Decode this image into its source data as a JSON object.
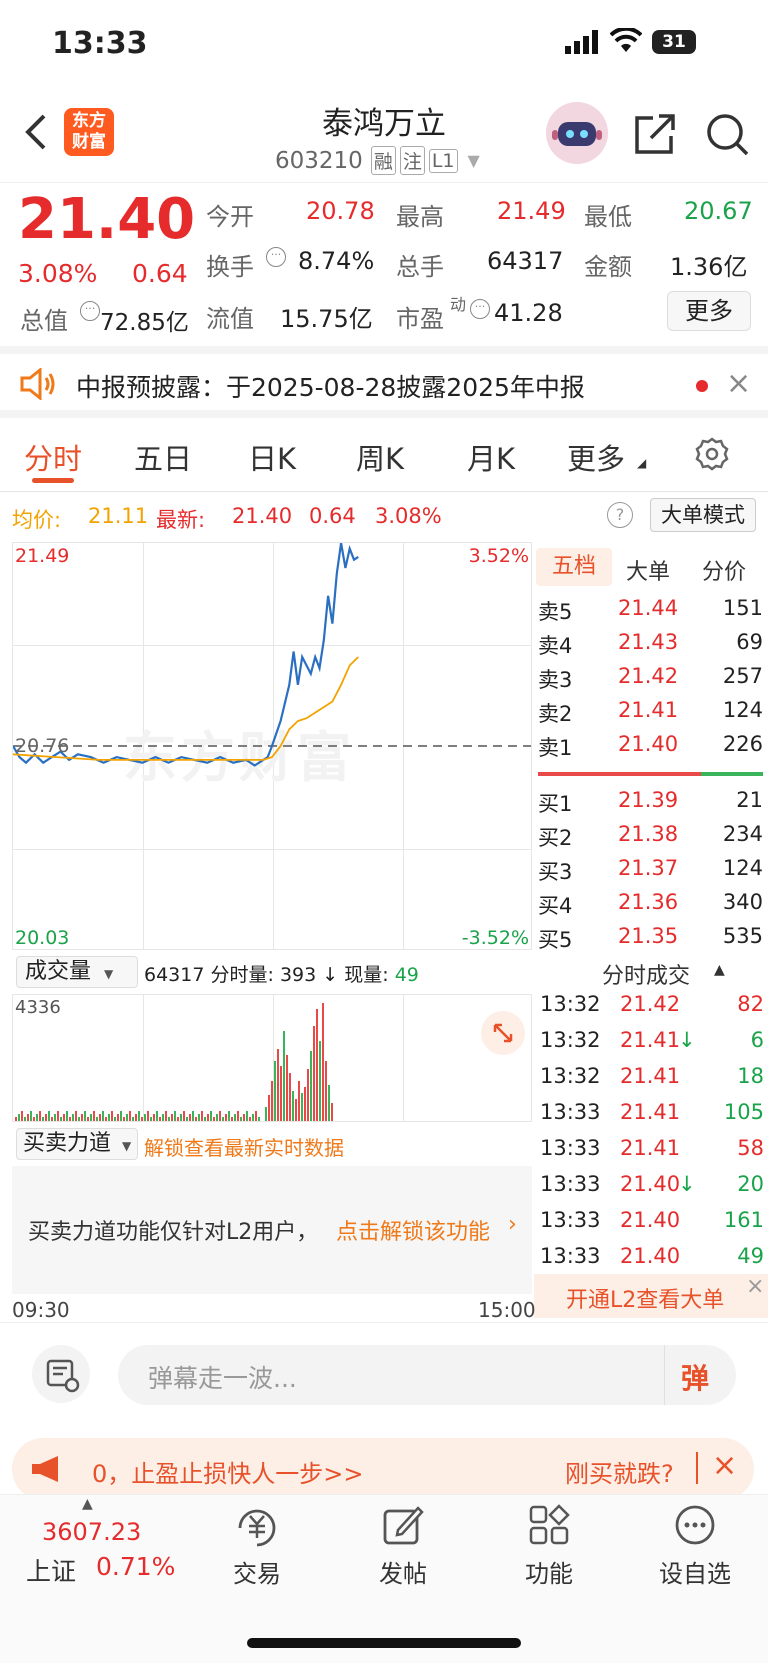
{
  "status_bar": {
    "time": "13:33",
    "battery": "31"
  },
  "header": {
    "stock_name": "泰鸿万立",
    "stock_code": "603210",
    "tags": [
      "融",
      "注",
      "L1"
    ]
  },
  "quote": {
    "price": "21.40",
    "change_pct": "3.08%",
    "change": "0.64",
    "open_label": "今开",
    "open": "20.78",
    "high_label": "最高",
    "high": "21.49",
    "low_label": "最低",
    "low": "20.67",
    "turnover_label": "换手",
    "turnover": "8.74%",
    "volume_label": "总手",
    "volume": "64317",
    "amount_label": "金额",
    "amount": "1.36亿",
    "mktcap_label": "总值",
    "mktcap": "72.85亿",
    "float_label": "流值",
    "float": "15.75亿",
    "pe_label": "市盈",
    "pe_sup": "动",
    "pe": "41.28",
    "more_button": "更多"
  },
  "notice": {
    "text": "中报预披露：于2025-08-28披露2025年中报"
  },
  "tabs": [
    "分时",
    "五日",
    "日K",
    "周K",
    "月K",
    "更多"
  ],
  "info_bar": {
    "avg_label": "均价:",
    "avg": "21.11",
    "last_label": "最新:",
    "last": "21.40",
    "chg": "0.64",
    "pct": "3.08%",
    "mode_button": "大单模式"
  },
  "chart_labels": {
    "y_top": "21.49",
    "y_mid": "20.76",
    "y_bottom": "20.03",
    "pct_top": "3.52%",
    "pct_bottom": "-3.52%",
    "watermark": "东方财富",
    "t_start": "09:30",
    "t_end": "15:00"
  },
  "chart_data": {
    "type": "line",
    "x_range": [
      "09:30",
      "15:00"
    ],
    "ylim": [
      20.03,
      21.49
    ],
    "pre_close": 20.76,
    "series": [
      {
        "color": "#2b6fc2",
        "x": [
          0,
          3,
          6,
          10,
          14,
          18,
          22,
          26,
          30,
          36,
          42,
          48,
          54,
          60,
          66,
          72,
          78,
          84,
          90,
          96,
          102,
          108,
          112,
          118,
          120,
          124,
          128,
          130,
          132,
          134,
          136,
          138,
          140,
          142,
          144,
          146,
          148,
          150,
          152,
          154,
          156,
          158,
          160
        ],
        "y": [
          20.76,
          20.72,
          20.7,
          20.73,
          20.7,
          20.72,
          20.74,
          20.71,
          20.73,
          20.72,
          20.7,
          20.72,
          20.71,
          20.7,
          20.72,
          20.7,
          20.72,
          20.71,
          20.7,
          20.72,
          20.7,
          20.71,
          20.69,
          20.72,
          20.76,
          20.85,
          20.98,
          21.1,
          20.98,
          21.08,
          21.05,
          21.02,
          21.08,
          21.04,
          21.14,
          21.3,
          21.2,
          21.38,
          21.49,
          21.4,
          21.47,
          21.43,
          21.44
        ]
      },
      {
        "color": "#f3a300",
        "x": [
          0,
          20,
          40,
          60,
          80,
          100,
          116,
          120,
          124,
          128,
          132,
          136,
          140,
          144,
          148,
          152,
          156,
          160
        ],
        "y": [
          20.73,
          20.72,
          20.71,
          20.71,
          20.71,
          20.71,
          20.71,
          20.72,
          20.76,
          20.82,
          20.85,
          20.86,
          20.88,
          20.9,
          20.92,
          20.98,
          21.05,
          21.08
        ]
      }
    ]
  },
  "order_book": {
    "tabs": [
      "五档",
      "大单",
      "分价"
    ],
    "asks": [
      {
        "label": "卖5",
        "price": "21.44",
        "vol": "151"
      },
      {
        "label": "卖4",
        "price": "21.43",
        "vol": "69"
      },
      {
        "label": "卖3",
        "price": "21.42",
        "vol": "257"
      },
      {
        "label": "卖2",
        "price": "21.41",
        "vol": "124"
      },
      {
        "label": "卖1",
        "price": "21.40",
        "vol": "226"
      }
    ],
    "bids": [
      {
        "label": "买1",
        "price": "21.39",
        "vol": "21"
      },
      {
        "label": "买2",
        "price": "21.38",
        "vol": "234"
      },
      {
        "label": "买3",
        "price": "21.37",
        "vol": "124"
      },
      {
        "label": "买4",
        "price": "21.36",
        "vol": "340"
      },
      {
        "label": "买5",
        "price": "21.35",
        "vol": "535"
      }
    ]
  },
  "volume_bar": {
    "selector": "成交量",
    "total": "64317",
    "tick_label": "分时量:",
    "tick": "393",
    "now_label": "现量:",
    "now": "49",
    "max": "4336"
  },
  "trades": {
    "title": "分时成交",
    "rows": [
      {
        "time": "13:32",
        "price": "21.42",
        "vol": "82",
        "dir": ""
      },
      {
        "time": "13:32",
        "price": "21.41",
        "vol": "6",
        "dir": "down"
      },
      {
        "time": "13:32",
        "price": "21.41",
        "vol": "18",
        "dir": ""
      },
      {
        "time": "13:33",
        "price": "21.41",
        "vol": "105",
        "dir": ""
      },
      {
        "time": "13:33",
        "price": "21.41",
        "vol": "58",
        "dir": ""
      },
      {
        "time": "13:33",
        "price": "21.40",
        "vol": "20",
        "dir": "down"
      },
      {
        "time": "13:33",
        "price": "21.40",
        "vol": "161",
        "dir": ""
      },
      {
        "time": "13:33",
        "price": "21.40",
        "vol": "49",
        "dir": ""
      }
    ],
    "l2_button": "开通L2查看大单"
  },
  "force_panel": {
    "selector": "买卖力道",
    "unlock_link": "解锁查看最新实时数据",
    "message": "买卖力道功能仅针对L2用户，",
    "action": "点击解锁该功能"
  },
  "comment": {
    "placeholder": "弹幕走一波...",
    "send": "弹"
  },
  "promo": {
    "left": "0，止盈止损快人一步>>",
    "right": "刚买就跌?"
  },
  "bottom_nav": {
    "index_value": "3607.23",
    "index_name": "上证",
    "index_pct": "0.71%",
    "items": [
      "交易",
      "发帖",
      "功能",
      "设自选"
    ]
  }
}
